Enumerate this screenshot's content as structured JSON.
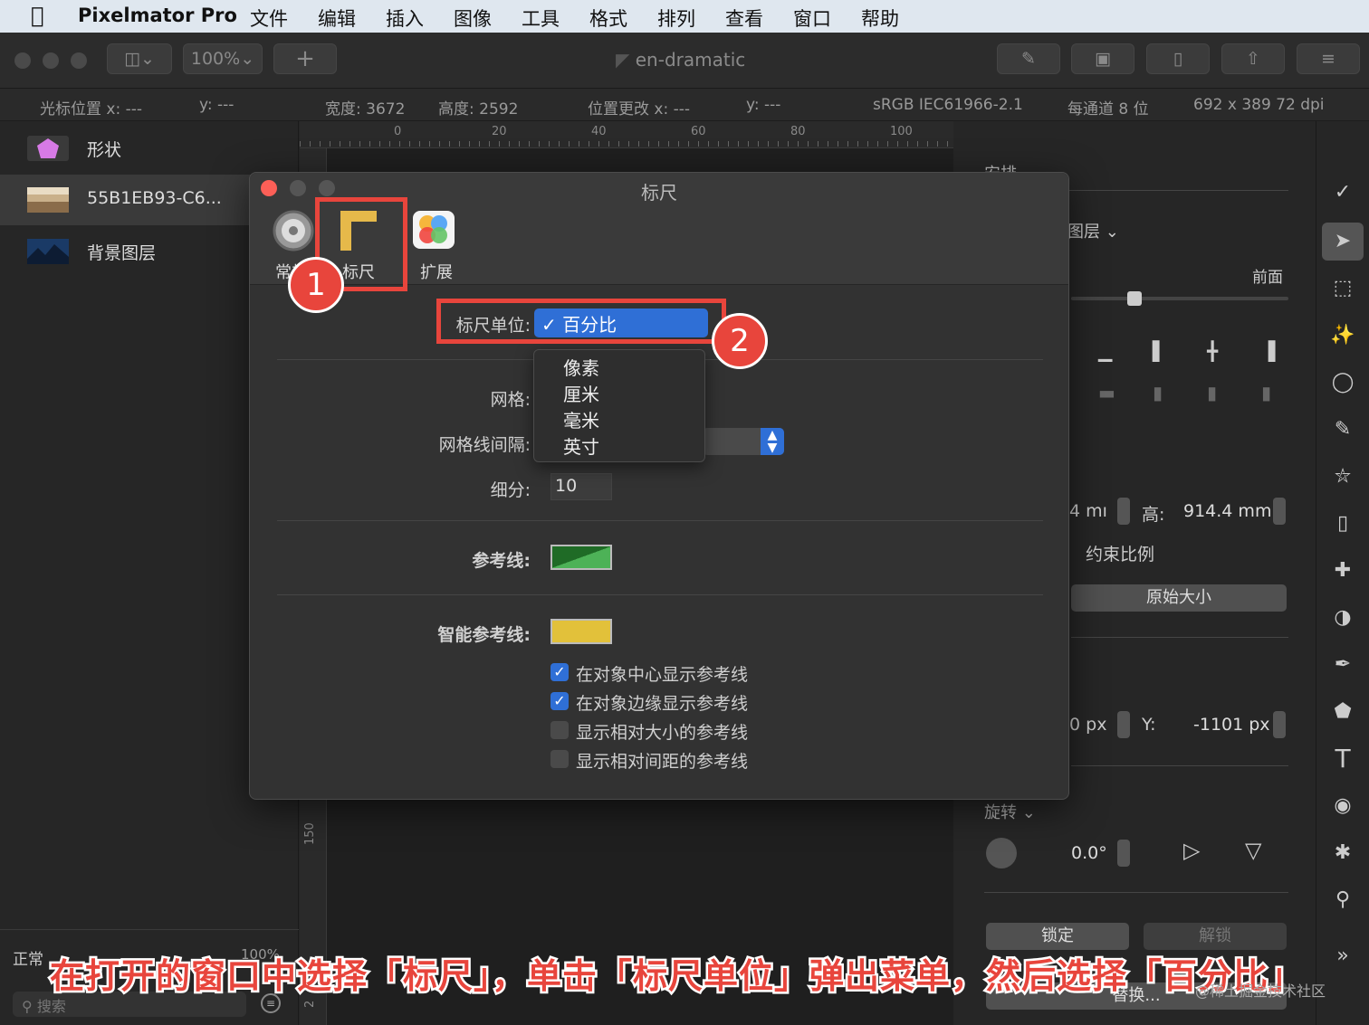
{
  "menubar": {
    "app_name": "Pixelmator Pro",
    "items": [
      "文件",
      "编辑",
      "插入",
      "图像",
      "工具",
      "格式",
      "排列",
      "查看",
      "窗口",
      "帮助"
    ]
  },
  "toolbar": {
    "zoom": "100%",
    "add": "+",
    "doc_title": "en-dramatic"
  },
  "infobar": {
    "cursor_x": "光标位置 x:  ---",
    "cursor_y": "y:  ---",
    "width": "宽度:  3672",
    "height": "高度:  2592",
    "pos_change_x": "位置更改 x:  ---",
    "pos_change_y": "y:  ---",
    "colorspace": "sRGB IEC61966-2.1",
    "bits": "每通道 8 位",
    "dims": "692 x 389 72 dpi"
  },
  "layers": {
    "items": [
      {
        "label": "形状"
      },
      {
        "label": "55B1EB93-C6..."
      },
      {
        "label": "背景图层"
      }
    ],
    "blend_mode": "正常",
    "opacity": "100%",
    "search_placeholder": "搜索"
  },
  "ruler": {
    "ticks": [
      "0",
      "20",
      "40",
      "60",
      "80",
      "100"
    ],
    "vertical_ticks": [
      "150",
      "2"
    ]
  },
  "right_panel": {
    "section_partial": "安排",
    "layer_dropdown": "图层 ⌄",
    "front_label": "前面",
    "width_partial": "4 mı",
    "height_label": "高:",
    "height_value": "914.4 mm",
    "constrain": "约束比例",
    "original_size": "原始大小",
    "x_partial": "0 px",
    "y_label": "Y:",
    "y_value": "-1101 px",
    "rotate_label": "旋转 ⌄",
    "rotate_value": "0.0°",
    "lock": "锁定",
    "unlock": "解锁",
    "replace": "替换..."
  },
  "dialog": {
    "title": "标尺",
    "tabs": [
      {
        "label": "常规"
      },
      {
        "label": "标尺"
      },
      {
        "label": "扩展"
      }
    ],
    "ruler_unit_label": "标尺单位:",
    "ruler_unit_value": "百分比",
    "grid_label": "网格:",
    "grid_spacing_label": "网格线间隔:",
    "subdivisions_label": "细分:",
    "subdivisions_value": "10",
    "guides_label": "参考线:",
    "smart_guides_label": "智能参考线:",
    "checkboxes": [
      {
        "label": "在对象中心显示参考线",
        "checked": true
      },
      {
        "label": "在对象边缘显示参考线",
        "checked": true
      },
      {
        "label": "显示相对大小的参考线",
        "checked": false
      },
      {
        "label": "显示相对间距的参考线",
        "checked": false
      }
    ],
    "popup_options": [
      "像素",
      "厘米",
      "毫米",
      "英寸"
    ],
    "colors": {
      "guide": "#2f8a34",
      "smart_guide": "#e2c13a"
    }
  },
  "annotations": {
    "badge1": "1",
    "badge2": "2",
    "caption": "在打开的窗口中选择「标尺」，单击「标尺单位」弹出菜单，然后选择「百分比」",
    "watermark": "@稀土掘金技术社区"
  }
}
